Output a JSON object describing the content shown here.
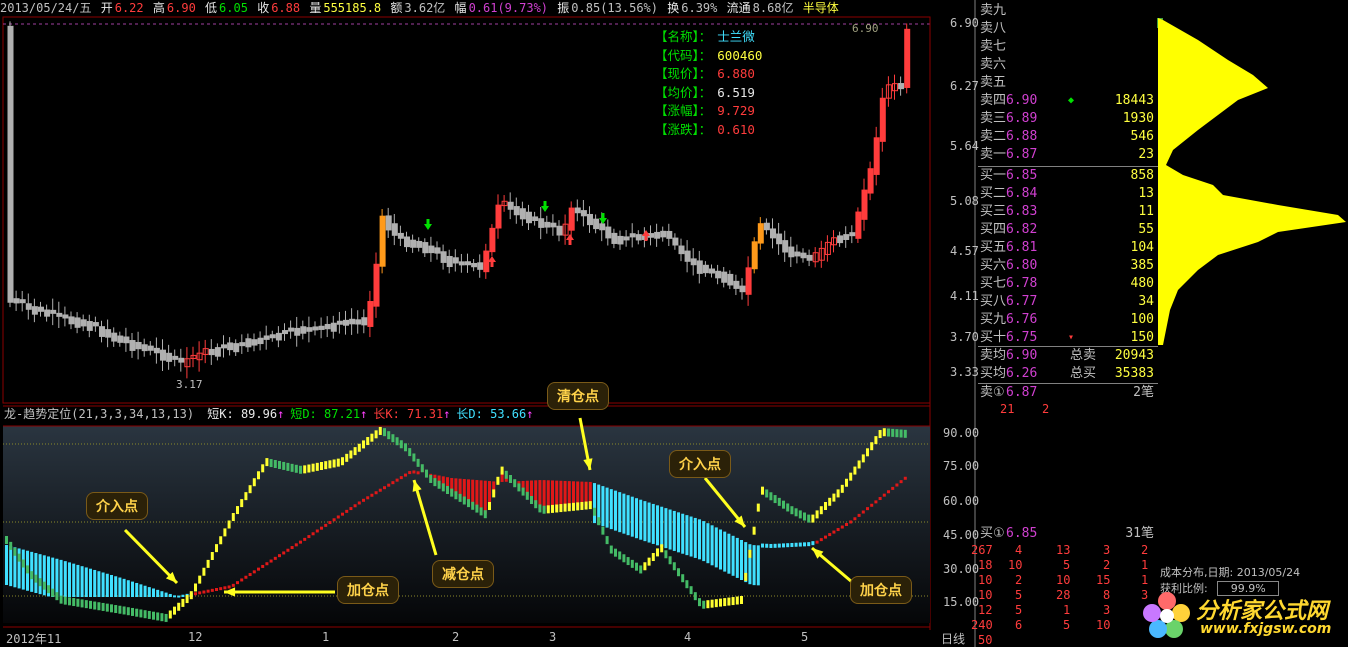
{
  "topbar": {
    "date": "2013/05/24/五",
    "open_label": "开",
    "open": "6.22",
    "high_label": "高",
    "high": "6.90",
    "low_label": "低",
    "low": "6.05",
    "close_label": "收",
    "close": "6.88",
    "vol_label": "量",
    "vol": "555185.8",
    "amt_label": "额",
    "amt": "3.62亿",
    "chg_label": "幅",
    "chg": "0.61(9.73%)",
    "amp_label": "振",
    "amp": "0.85(13.56%)",
    "turn_label": "换",
    "turn": "6.39%",
    "float_label": "流通",
    "float": "8.68亿",
    "sector": "半导体"
  },
  "info_box": {
    "rows": [
      {
        "k": "【名称】：",
        "v": "士兰微",
        "vcolor": "#40e0ff"
      },
      {
        "k": "【代码】：",
        "v": "600460",
        "vcolor": "#ffff40"
      },
      {
        "k": "【现价】：",
        "v": "6.880",
        "vcolor": "#ff3c3c"
      },
      {
        "k": "【均价】：",
        "v": "6.519",
        "vcolor": "#e8e8e8"
      },
      {
        "k": "【涨幅】：",
        "v": "9.729",
        "vcolor": "#ff3c3c"
      },
      {
        "k": "【涨跌】：",
        "v": "0.610",
        "vcolor": "#ff3c3c"
      }
    ]
  },
  "price_axis": [
    "6.90",
    "6.27",
    "5.64",
    "5.08",
    "4.57",
    "4.11",
    "3.70",
    "3.33"
  ],
  "low_mark": "3.17",
  "high_mark": "6.90",
  "indicator": {
    "name": "龙-趋势定位(21,3,3,34,13,13)",
    "items": [
      {
        "label": "短K:",
        "value": "89.96",
        "arrow": "↑",
        "color": "#e8e8e8"
      },
      {
        "label": "短D:",
        "value": "87.21",
        "arrow": "↑",
        "color": "#00e000"
      },
      {
        "label": "长K:",
        "value": "71.31",
        "arrow": "↑",
        "color": "#ff3c3c"
      },
      {
        "label": "长D:",
        "value": "53.66",
        "arrow": "↑",
        "color": "#40e0ff"
      }
    ],
    "axis": [
      "90.00",
      "75.00",
      "60.00",
      "45.00",
      "30.00",
      "15.00"
    ]
  },
  "callouts": {
    "c1": "介入点",
    "c2": "加仓点",
    "c3": "减仓点",
    "c4": "清仓点",
    "c5": "介入点",
    "c6": "加仓点"
  },
  "time_axis": [
    "2012年11",
    "12",
    "1",
    "2",
    "3",
    "4",
    "5"
  ],
  "period": "日线",
  "orderbook": {
    "sell": [
      {
        "name": "卖九",
        "price": "",
        "vol": ""
      },
      {
        "name": "卖八",
        "price": "",
        "vol": ""
      },
      {
        "name": "卖七",
        "price": "",
        "vol": ""
      },
      {
        "name": "卖六",
        "price": "",
        "vol": ""
      },
      {
        "name": "卖五",
        "price": "",
        "vol": ""
      },
      {
        "name": "卖四",
        "price": "6.90",
        "vol": "18443"
      },
      {
        "name": "卖三",
        "price": "6.89",
        "vol": "1930"
      },
      {
        "name": "卖二",
        "price": "6.88",
        "vol": "546"
      },
      {
        "name": "卖一",
        "price": "6.87",
        "vol": "23"
      }
    ],
    "buy": [
      {
        "name": "买一",
        "price": "6.85",
        "vol": "858"
      },
      {
        "name": "买二",
        "price": "6.84",
        "vol": "13"
      },
      {
        "name": "买三",
        "price": "6.83",
        "vol": "11"
      },
      {
        "name": "买四",
        "price": "6.82",
        "vol": "55"
      },
      {
        "name": "买五",
        "price": "6.81",
        "vol": "104"
      },
      {
        "name": "买六",
        "price": "6.80",
        "vol": "385"
      },
      {
        "name": "买七",
        "price": "6.78",
        "vol": "480"
      },
      {
        "name": "买八",
        "price": "6.77",
        "vol": "34"
      },
      {
        "name": "买九",
        "price": "6.76",
        "vol": "100"
      },
      {
        "name": "买十",
        "price": "6.75",
        "vol": "150"
      }
    ],
    "sell_avg_label": "卖均",
    "sell_avg": "6.90",
    "total_sell_label": "总卖",
    "total_sell": "20943",
    "buy_avg_label": "买均",
    "buy_avg": "6.26",
    "total_buy_label": "总买",
    "total_buy": "35383",
    "sell1_label": "卖①",
    "sell1_price": "6.87",
    "sell1_count": "2笔",
    "sell1_queue": [
      "21",
      "2"
    ],
    "buy1_label": "买①",
    "buy1_price": "6.85",
    "buy1_count": "31笔",
    "buy1_queue": [
      [
        "267",
        "4",
        "13",
        "3",
        "2"
      ],
      [
        "18",
        "10",
        "5",
        "2",
        "1"
      ],
      [
        "10",
        "2",
        "10",
        "15",
        "1"
      ],
      [
        "10",
        "5",
        "28",
        "8",
        "3"
      ],
      [
        "12",
        "5",
        "1",
        "3",
        ""
      ],
      [
        "240",
        "6",
        "5",
        "10",
        ""
      ],
      [
        "50",
        "",
        "",
        "",
        ""
      ]
    ]
  },
  "cost_dist": {
    "title": "成本分布,日期: 2013/05/24",
    "profit_label": "获利比例:",
    "profit": "99.9%"
  },
  "logo": {
    "name": "分析家公式网",
    "url": "www.fxjgsw.com"
  },
  "colors": {
    "up": "#ff3c3c",
    "down": "#b0b0b0",
    "grid": "#8b0000",
    "highlight": "#ff9a1a",
    "cyan": "#40e0ff",
    "yellow": "#ffff30",
    "green": "#44bb66"
  }
}
